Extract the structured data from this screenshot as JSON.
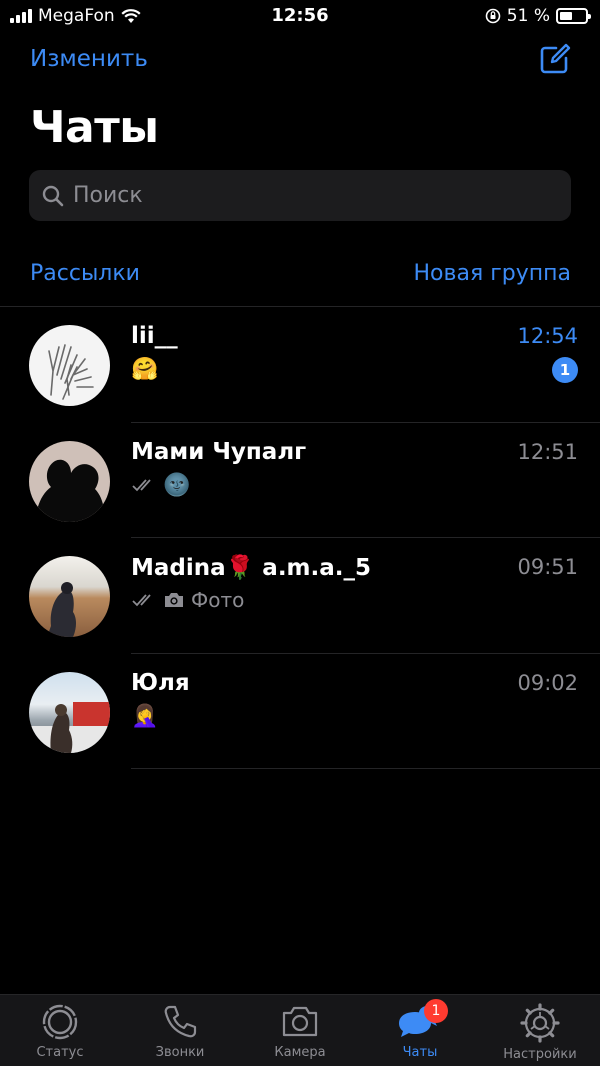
{
  "status_bar": {
    "carrier": "MegaFon",
    "time": "12:56",
    "battery_percent": "51 %",
    "battery_level": 0.51,
    "icons": [
      "cellular-signal-icon",
      "wifi-icon",
      "orientation-lock-icon",
      "battery-icon"
    ]
  },
  "header": {
    "edit_label": "Изменить",
    "title": "Чаты",
    "compose_icon": "compose-icon"
  },
  "search": {
    "placeholder": "Поиск",
    "icon": "search-icon"
  },
  "links": {
    "broadcast_label": "Рассылки",
    "new_group_label": "Новая группа"
  },
  "chats": [
    {
      "name": "lii__",
      "time": "12:54",
      "preview": "🤗",
      "unread": "1",
      "read_receipt": false,
      "time_unread": true
    },
    {
      "name": "Мами Чупалг",
      "time": "12:51",
      "preview": "🌚",
      "read_receipt": true
    },
    {
      "name": "Madina🌹 a.m.a._5",
      "time": "09:51",
      "preview": "Фото",
      "read_receipt": true,
      "attachment": "camera-icon"
    },
    {
      "name": "Юля",
      "time": "09:02",
      "preview": "🤦‍♀️",
      "read_receipt": false
    }
  ],
  "tabs": [
    {
      "label": "Статус",
      "icon": "status-icon"
    },
    {
      "label": "Звонки",
      "icon": "phone-icon"
    },
    {
      "label": "Камера",
      "icon": "camera-icon"
    },
    {
      "label": "Чаты",
      "icon": "chats-icon",
      "badge": "1",
      "active": true
    },
    {
      "label": "Настройки",
      "icon": "settings-icon"
    }
  ],
  "colors": {
    "accent": "#3d8bf5",
    "background": "#000000",
    "secondary_text": "#8d8d93",
    "badge_red": "#ff3b30"
  }
}
